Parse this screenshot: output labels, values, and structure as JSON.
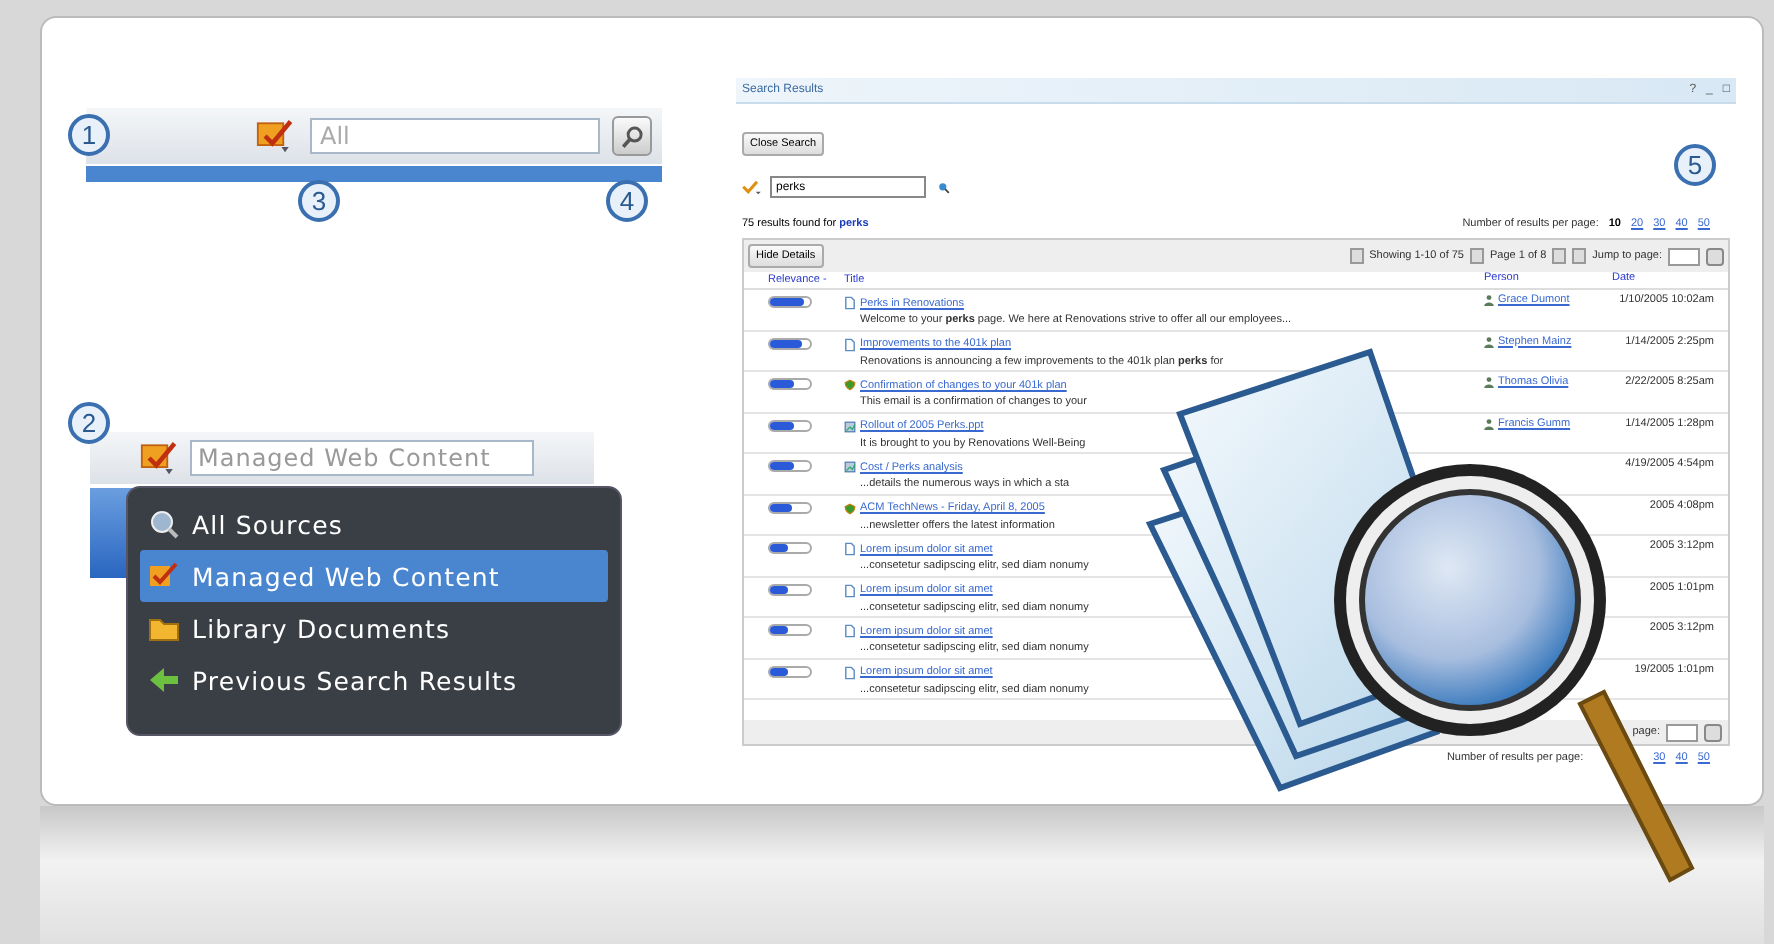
{
  "callouts": [
    "1",
    "2",
    "3",
    "4",
    "5"
  ],
  "toolbar_search": {
    "value": "All"
  },
  "scope_search": {
    "value": "Managed Web Content"
  },
  "scope_menu": [
    {
      "label": "All Sources",
      "kind": "sources",
      "selected": false
    },
    {
      "label": "Managed Web Content",
      "kind": "web",
      "selected": true
    },
    {
      "label": "Library Documents",
      "kind": "library",
      "selected": false
    },
    {
      "label": "Previous Search Results",
      "kind": "previous",
      "selected": false
    }
  ],
  "results_panel": {
    "title": "Search Results",
    "window_controls": [
      "?",
      "_",
      "□"
    ],
    "close_button": "Close Search",
    "query": "perks",
    "summary": "75 results found for **perks**",
    "per_page_label": "Number of results per page:",
    "per_page_options": [
      {
        "label": "10",
        "selected": true
      },
      {
        "label": "20",
        "selected": false
      },
      {
        "label": "30",
        "selected": false
      },
      {
        "label": "40",
        "selected": false
      },
      {
        "label": "50",
        "selected": false
      }
    ],
    "hide_details": "Hide Details",
    "showing": "Showing 1-10 of 75",
    "page": "Page 1 of 8",
    "jump_label": "Jump to page:",
    "columns": [
      "Relevance -",
      "Title",
      "Person",
      "Date"
    ],
    "rows": [
      {
        "level": 0.85,
        "kind": "page",
        "title": "Perks in Renovations",
        "description": "Welcome to your **perks** page. We here at Renovations strive to offer all our employees...",
        "person": "Grace Dumont",
        "date": "1/10/2005 10:02am"
      },
      {
        "level": 0.8,
        "kind": "page",
        "title": "Improvements to the 401k plan",
        "description": "Renovations is announcing a few improvements to the 401k plan **perks** for",
        "person": "Stephen Mainz",
        "date": "1/14/2005 2:25pm"
      },
      {
        "level": 0.6,
        "kind": "shield",
        "title": "Confirmation of changes to your 401k plan",
        "description": "This email is a confirmation of changes to your",
        "person": "Thomas Olivia",
        "date": "2/22/2005 8:25am"
      },
      {
        "level": 0.6,
        "kind": "chart",
        "title": "Rollout of 2005 Perks.ppt",
        "description": "It is brought to you by Renovations Well-Being",
        "person": "Francis Gumm",
        "date": "1/14/2005 1:28pm"
      },
      {
        "level": 0.6,
        "kind": "chart",
        "title": "Cost / Perks analysis",
        "description": "...details the numerous ways in which a sta",
        "date": "4/19/2005 4:54pm"
      },
      {
        "level": 0.55,
        "kind": "shield",
        "title": "ACM TechNews - Friday, April 8, 2005",
        "description": "...newsletter offers the latest information",
        "date": "2005 4:08pm"
      },
      {
        "level": 0.45,
        "kind": "page",
        "title": "Lorem ipsum dolor sit amet",
        "description": "...consetetur sadipscing elitr, sed diam nonumy",
        "date": "2005 3:12pm"
      },
      {
        "level": 0.45,
        "kind": "page",
        "title": "Lorem ipsum dolor sit amet",
        "description": "...consetetur sadipscing elitr, sed diam nonumy",
        "date": "2005 1:01pm"
      },
      {
        "level": 0.45,
        "kind": "page",
        "title": "Lorem ipsum dolor sit amet",
        "description": "...consetetur sadipscing elitr, sed diam nonumy",
        "date": "2005 3:12pm"
      },
      {
        "level": 0.45,
        "kind": "page",
        "title": "Lorem ipsum dolor sit amet",
        "description": "...consetetur sadipscing elitr, sed diam nonumy",
        "date": "19/2005 1:01pm"
      }
    ],
    "footer_jump_label": "page:",
    "footer_per_page_label": "Number of results per page:",
    "footer_per_page_options": [
      "30",
      "40",
      "50"
    ]
  }
}
